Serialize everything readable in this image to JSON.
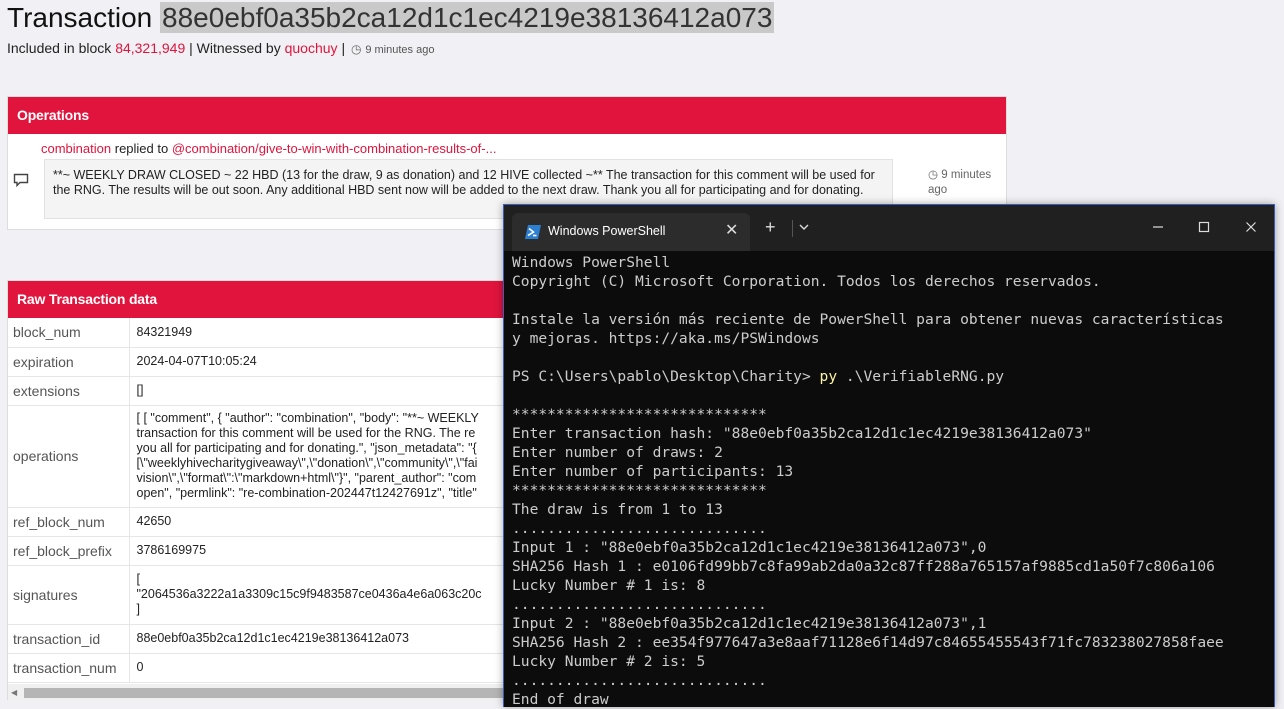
{
  "header": {
    "title_prefix": "Transaction",
    "tx_hash": "88e0ebf0a35b2ca12d1c1ec4219e38136412a073",
    "included_in_block_label": "Included in block",
    "block_number": "84,321,949",
    "witnessed_by_label": "| Witnessed by",
    "witness": "quochuy",
    "separator": "|",
    "time_ago": "9 minutes ago"
  },
  "operations": {
    "title": "Operations",
    "author": "combination",
    "replied_to_label": "replied to",
    "parent_link": "@combination/give-to-win-with-combination-results-of-...",
    "body": "**~ WEEKLY DRAW CLOSED ~ 22 HBD (13 for the draw, 9 as donation) and 12 HIVE collected ~** The transaction for this comment will be used for the RNG. The results will be out soon. Any additional HBD sent now will be added to the next draw. Thank you all for participating and for donating.",
    "time_ago": "9 minutes ago"
  },
  "raw": {
    "title": "Raw Transaction data",
    "rows": [
      {
        "key": "block_num",
        "lines": [
          "84321949"
        ]
      },
      {
        "key": "expiration",
        "lines": [
          "2024-04-07T10:05:24"
        ]
      },
      {
        "key": "extensions",
        "lines": [
          "[]"
        ]
      },
      {
        "key": "operations",
        "lines": [
          "[ [ \"comment\", { \"author\": \"combination\", \"body\": \"**~ WEEKLY",
          "transaction for this comment will be used for the RNG. The re",
          "you all for participating and for donating.\", \"json_metadata\": \"{",
          "[\\\"weeklyhivecharitygiveaway\\\",\\\"donation\\\",\\\"community\\\",\\\"fai",
          "vision\\\",\\\"format\\\":\\\"markdown+html\\\"}\", \"parent_author\": \"com",
          "open\", \"permlink\": \"re-combination-202447t12427691z\", \"title\""
        ]
      },
      {
        "key": "ref_block_num",
        "lines": [
          "42650"
        ]
      },
      {
        "key": "ref_block_prefix",
        "lines": [
          "3786169975"
        ]
      },
      {
        "key": "signatures",
        "lines": [
          "[",
          "\"2064536a3222a1a3309c15c9f9483587ce0436a4e6a063c20c",
          "]"
        ]
      },
      {
        "key": "transaction_id",
        "lines": [
          "88e0ebf0a35b2ca12d1c1ec4219e38136412a073"
        ]
      },
      {
        "key": "transaction_num",
        "lines": [
          "0"
        ]
      }
    ]
  },
  "powershell": {
    "tab_title": "Windows PowerShell",
    "lines": [
      "Windows PowerShell",
      "Copyright (C) Microsoft Corporation. Todos los derechos reservados.",
      "",
      "Instale la versión más reciente de PowerShell para obtener nuevas características",
      "y mejoras. https://aka.ms/PSWindows",
      "",
      "PS C:\\Users\\pablo\\Desktop\\Charity> ",
      "",
      "*****************************",
      "Enter transaction hash: \"88e0ebf0a35b2ca12d1c1ec4219e38136412a073\"",
      "Enter number of draws: 2",
      "Enter number of participants: 13",
      "*****************************",
      "The draw is from 1 to 13",
      ".............................",
      "Input 1 : \"88e0ebf0a35b2ca12d1c1ec4219e38136412a073\",0",
      "SHA256 Hash 1 : e0106fd99bb7c8fa99ab2da0a32c87ff288a765157af9885cd1a50f7c806a106",
      "Lucky Number # 1 is: 8",
      ".............................",
      "Input 2 : \"88e0ebf0a35b2ca12d1c1ec4219e38136412a073\",1",
      "SHA256 Hash 2 : ee354f977647a3e8aaf71128e6f14d97c84655455543f71fc783238027858faee",
      "Lucky Number # 2 is: 5",
      ".............................",
      "End of draw"
    ],
    "prompt_cmd": "py",
    "prompt_arg": " .\\VerifiableRNG.py"
  }
}
